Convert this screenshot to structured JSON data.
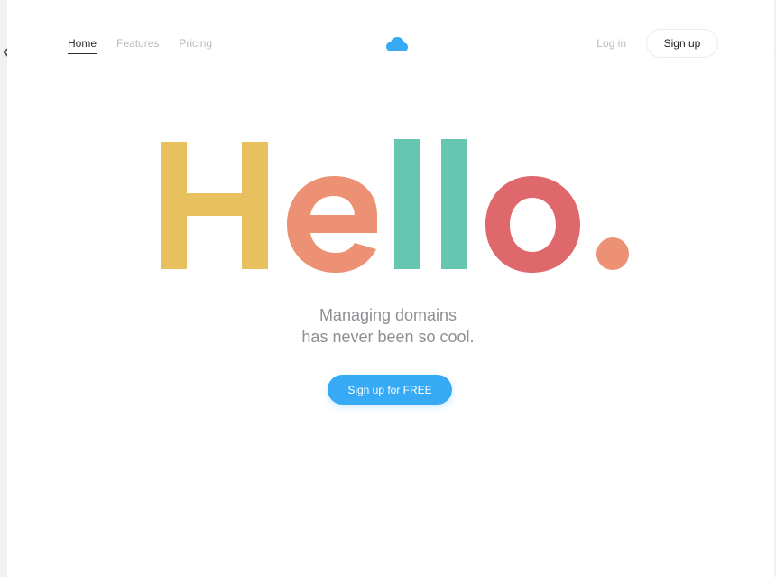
{
  "nav": {
    "links": [
      {
        "label": "Home",
        "active": true
      },
      {
        "label": "Features",
        "active": false
      },
      {
        "label": "Pricing",
        "active": false
      }
    ],
    "login_label": "Log in",
    "signup_label": "Sign up"
  },
  "carousel": {
    "prev_icon": "chevron-left-icon",
    "next_icon": "chevron-right-icon"
  },
  "logo": {
    "icon": "cloud-icon",
    "color": "#36aaf5"
  },
  "hero": {
    "headline": "Hello.",
    "letter_colors": {
      "H": "#e8c05d",
      "e": "#ec9174",
      "l1": "#66c6b0",
      "l2": "#66c6b0",
      "o": "#de686c",
      "dot": "#ec9174"
    },
    "subtitle_line1": "Managing domains",
    "subtitle_line2": "has never been so cool.",
    "cta_label": "Sign up for FREE"
  },
  "colors": {
    "accent": "#36aaf5",
    "muted_text": "#8e8f93",
    "nav_inactive": "#b9babd"
  }
}
